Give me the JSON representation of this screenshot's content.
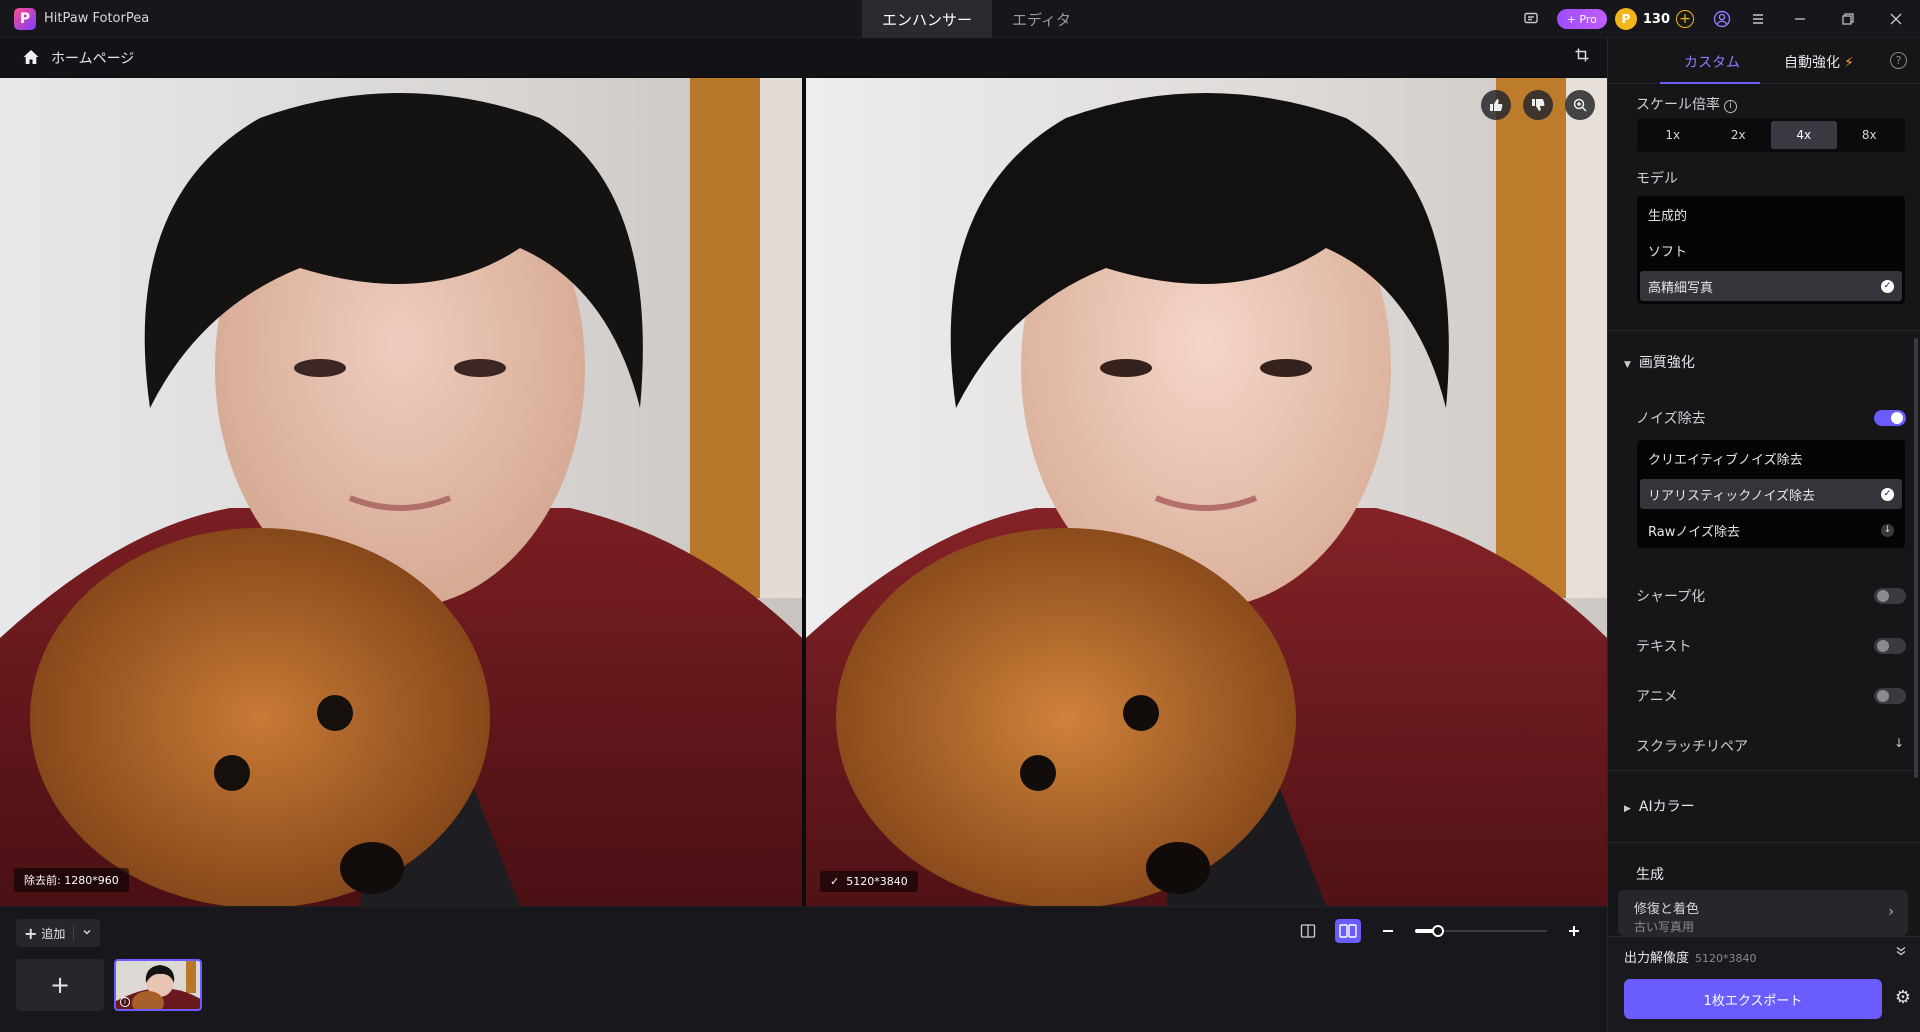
{
  "titlebar": {
    "app_title": "HitPaw FotorPea",
    "tabs": [
      {
        "label": "エンハンサー",
        "active": true
      },
      {
        "label": "エディタ",
        "active": false
      }
    ],
    "pro_label": "+ Pro",
    "coin_icon": "P",
    "coin_count": "130"
  },
  "breadcrumb": {
    "home_label": "ホームページ"
  },
  "panes": {
    "before_label": "除去前: 1280*960",
    "after_label": "5120*3840"
  },
  "bottom": {
    "add_label": "追加",
    "zoom_level": 0.14
  },
  "panel": {
    "tabs": {
      "custom": "カスタム",
      "auto": "自動強化"
    },
    "scale": {
      "label": "スケール倍率",
      "options": [
        "1x",
        "2x",
        "4x",
        "8x"
      ],
      "selected": "4x"
    },
    "model": {
      "label": "モデル",
      "options": [
        {
          "label": "生成的",
          "selected": false
        },
        {
          "label": "ソフト",
          "selected": false
        },
        {
          "label": "高精細写真",
          "selected": true
        }
      ]
    },
    "quality": {
      "header": "画質強化",
      "noise": {
        "label": "ノイズ除去",
        "enabled": true,
        "options": [
          {
            "label": "クリエイティブノイズ除去",
            "selected": false
          },
          {
            "label": "リアリスティックノイズ除去",
            "selected": true
          },
          {
            "label": "Rawノイズ除去",
            "selected": false,
            "download": true
          }
        ]
      },
      "sharpen": {
        "label": "シャープ化",
        "enabled": false
      },
      "text": {
        "label": "テキスト",
        "enabled": false
      },
      "anime": {
        "label": "アニメ",
        "enabled": false
      },
      "scratch": {
        "label": "スクラッチリペア"
      }
    },
    "ai_color": {
      "header": "AIカラー"
    },
    "generate": {
      "header": "生成",
      "card_title": "修復と着色",
      "card_sub": "古い写真用"
    },
    "output": {
      "label": "出力解像度",
      "value": "5120*3840",
      "export_label": "1枚エクスポート"
    }
  }
}
